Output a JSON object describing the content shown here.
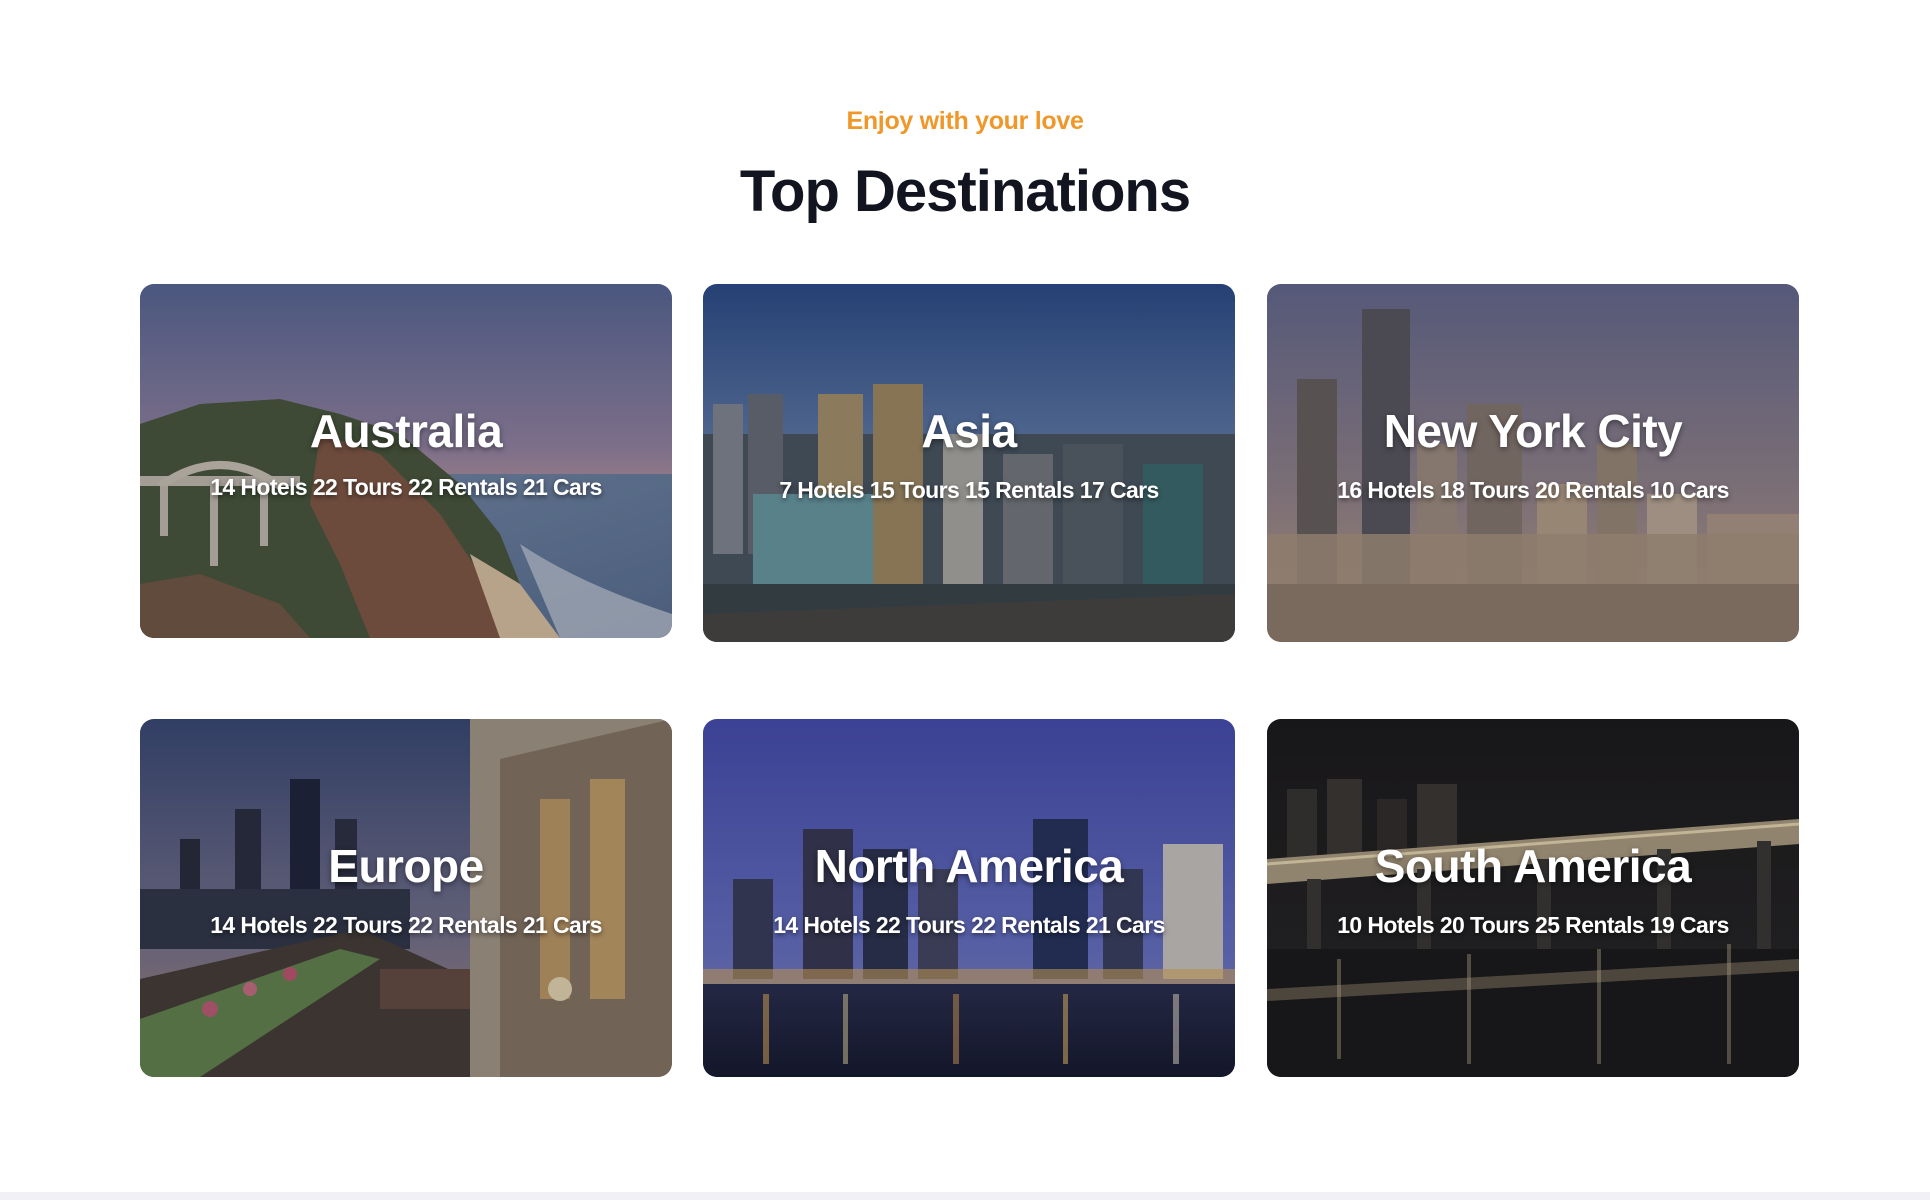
{
  "section": {
    "eyebrow": "Enjoy with your love",
    "title": "Top Destinations"
  },
  "cards": [
    {
      "name": "Australia",
      "stats": "14 Hotels 22 Tours 22 Rentals 21 Cars"
    },
    {
      "name": "Asia",
      "stats": "7 Hotels 15 Tours 15 Rentals 17 Cars"
    },
    {
      "name": "New York City",
      "stats": "16 Hotels 18 Tours 20 Rentals 10 Cars"
    },
    {
      "name": "Europe",
      "stats": "14 Hotels 22 Tours 22 Rentals 21 Cars"
    },
    {
      "name": "North America",
      "stats": "14 Hotels 22 Tours 22 Rentals 21 Cars"
    },
    {
      "name": "South America",
      "stats": "10 Hotels 20 Tours 25 Rentals 19 Cars"
    }
  ],
  "colors": {
    "accent": "#f0972a",
    "heading": "#12151f",
    "card_text": "#ffffff"
  }
}
